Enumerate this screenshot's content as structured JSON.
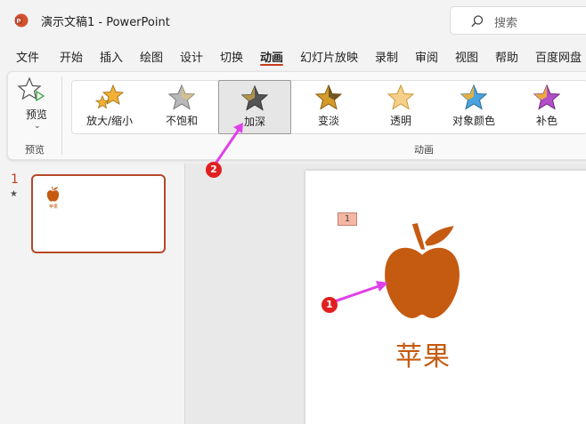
{
  "window": {
    "title": "演示文稿1  -  PowerPoint",
    "search_placeholder": "搜索"
  },
  "menu": {
    "tabs": [
      "文件",
      "开始",
      "插入",
      "绘图",
      "设计",
      "切换",
      "动画",
      "幻灯片放映",
      "录制",
      "审阅",
      "视图",
      "帮助",
      "百度网盘"
    ],
    "active_tab": "动画"
  },
  "ribbon": {
    "preview": {
      "button_label": "预览",
      "group_label": "预览"
    },
    "animations": {
      "group_label": "动画",
      "items": [
        {
          "label": "放大/缩小",
          "icon": "grow-shrink-star-icon",
          "color": "#f2b134"
        },
        {
          "label": "不饱和",
          "icon": "desaturate-star-icon",
          "color": "#b0b0b0"
        },
        {
          "label": "加深",
          "icon": "darken-star-icon",
          "color": "#555555",
          "selected": true
        },
        {
          "label": "变淡",
          "icon": "lighten-star-icon",
          "color": "#d49b2a"
        },
        {
          "label": "透明",
          "icon": "transparency-star-icon",
          "color": "#f6d08a"
        },
        {
          "label": "对象颜色",
          "icon": "object-color-star-icon",
          "color": "#4aa3df"
        },
        {
          "label": "补色",
          "icon": "complementary-color-star-icon",
          "color": "#b04fc7"
        }
      ]
    }
  },
  "slides_panel": {
    "slide_number": "1",
    "thumbnail_text": "苹果"
  },
  "slide": {
    "animation_tag": "1",
    "text": "苹果",
    "object_color": "#c55a11"
  },
  "annotations": {
    "marker1": "1",
    "marker2": "2",
    "arrow_color": "#e040e8"
  }
}
